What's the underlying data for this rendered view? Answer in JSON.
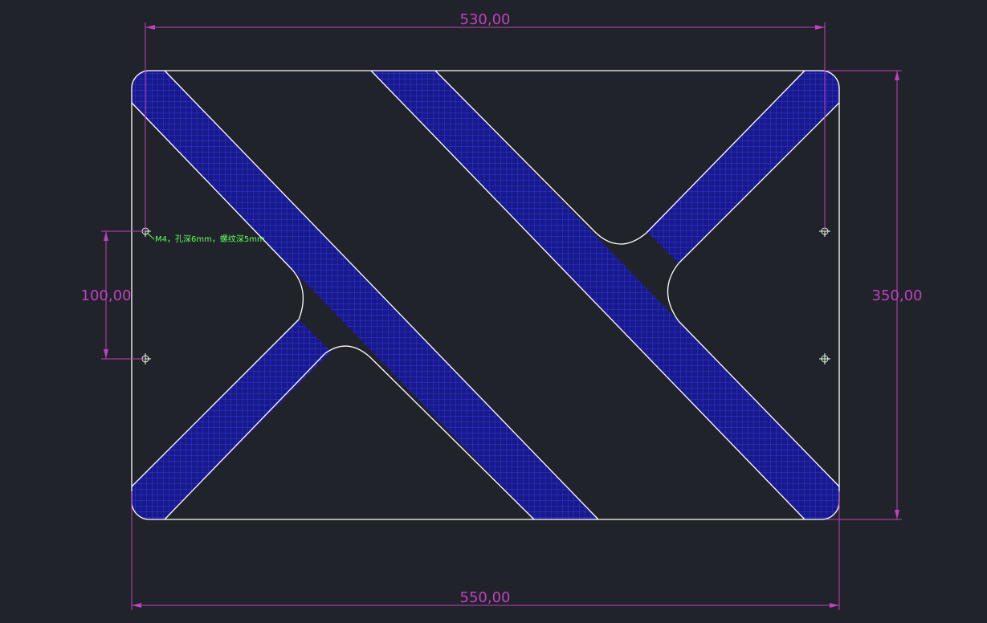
{
  "dimensions": {
    "top_width": "530,00",
    "bottom_width": "550,00",
    "right_height": "350,00",
    "left_spacing": "100,00"
  },
  "annotation": {
    "hole_note": "M4，孔深6mm，螺纹深5mm"
  },
  "colors": {
    "background": "#21232a",
    "outline": "#ffffff",
    "dimension": "#c040c0",
    "hatch": "#1a18c8",
    "hatch_grid": "#3a34e0",
    "note": "#60ff60"
  }
}
